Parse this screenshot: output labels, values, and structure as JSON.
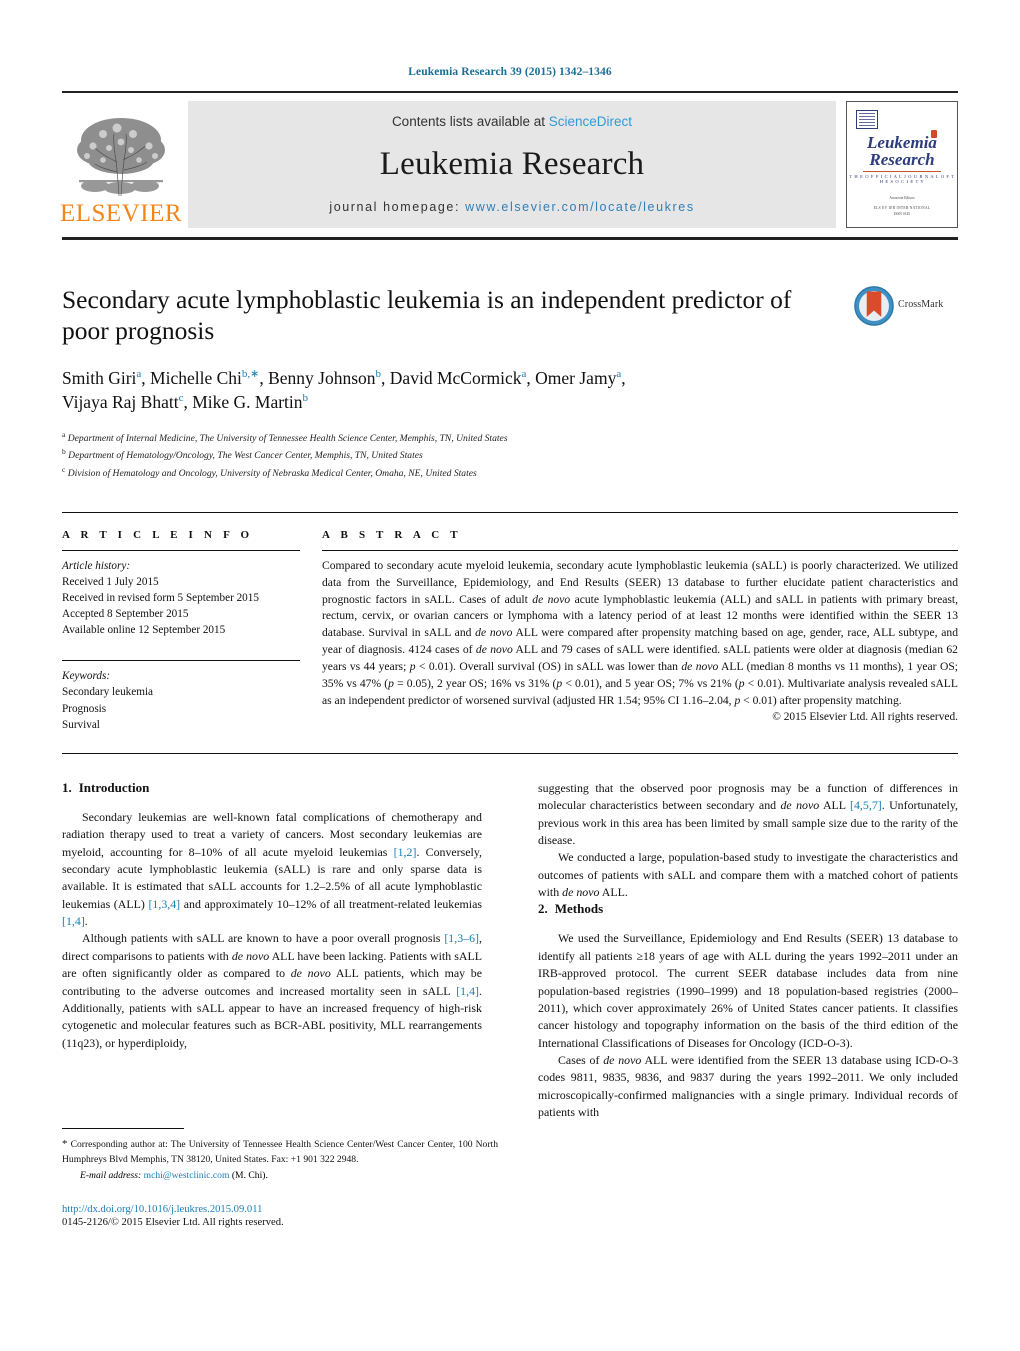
{
  "running_head": "Leukemia Research 39 (2015) 1342–1346",
  "masthead": {
    "publisher_name": "ELSEVIER",
    "contents_prefix": "Contents lists available at ",
    "contents_link": "ScienceDirect",
    "journal_title": "Leukemia Research",
    "homepage_prefix": "journal homepage: ",
    "homepage_link": "www.elsevier.com/locate/leukres",
    "cover": {
      "title_line1": "Leukemia",
      "title_line2": "Research",
      "subtitle": "T H E  O F F I C I A L  J O U R N A L  O F  T H E  S O C I E T Y",
      "meta_line1": "Associate Editors",
      "meta_line2": "ELS EV IER      INTER NATIONAL",
      "meta_line3": "ISSN                       0145"
    }
  },
  "article": {
    "title": "Secondary acute lymphoblastic leukemia is an independent predictor of poor prognosis",
    "authors_line1_parts": [
      {
        "name": "Smith Giri",
        "sup": "a",
        "sep": ", "
      },
      {
        "name": "Michelle Chi",
        "sup": "b,∗",
        "sep": ", "
      },
      {
        "name": "Benny Johnson",
        "sup": "b",
        "sep": ", "
      },
      {
        "name": "David McCormick",
        "sup": "a",
        "sep": ", "
      },
      {
        "name": "Omer Jamy",
        "sup": "a",
        "sep": ","
      }
    ],
    "authors_line2_parts": [
      {
        "name": "Vijaya Raj Bhatt",
        "sup": "c",
        "sep": ", "
      },
      {
        "name": "Mike G. Martin",
        "sup": "b",
        "sep": ""
      }
    ],
    "affiliations": [
      {
        "marker": "a",
        "text": "Department of Internal Medicine, The University of Tennessee Health Science Center, Memphis, TN, United States"
      },
      {
        "marker": "b",
        "text": "Department of Hematology/Oncology, The West Cancer Center, Memphis, TN, United States"
      },
      {
        "marker": "c",
        "text": "Division of Hematology and Oncology, University of Nebraska Medical Center, Omaha, NE, United States"
      }
    ],
    "crossmark_label": "CrossMark"
  },
  "article_info": {
    "heading": "A R T I C L E   I N F O",
    "history_label": "Article history:",
    "history": [
      "Received 1 July 2015",
      "Received in revised form 5 September 2015",
      "Accepted 8 September 2015",
      "Available online 12 September 2015"
    ],
    "keywords_label": "Keywords:",
    "keywords": [
      "Secondary leukemia",
      "Prognosis",
      "Survival"
    ]
  },
  "abstract": {
    "heading": "A B S T R A C T",
    "body_html": "Compared to secondary acute myeloid leukemia, secondary acute lymphoblastic leukemia (sALL) is poorly characterized. We utilized data from the Surveillance, Epidemiology, and End Results (SEER) 13 database to further elucidate patient characteristics and prognostic factors in sALL. Cases of adult <span class=\"ital\">de novo</span> acute lymphoblastic leukemia (ALL) and sALL in patients with primary breast, rectum, cervix, or ovarian cancers or lymphoma with a latency period of at least 12 months were identified within the SEER 13 database. Survival in sALL and <span class=\"ital\">de novo</span> ALL were compared after propensity matching based on age, gender, race, ALL subtype, and year of diagnosis. 4124 cases of <span class=\"ital\">de novo</span> ALL and 79 cases of sALL were identified. sALL patients were older at diagnosis (median 62 years vs 44 years; <span class=\"ital\">p</span> &lt; 0.01). Overall survival (OS) in sALL was lower than <span class=\"ital\">de novo</span> ALL (median 8 months vs 11 months), 1 year OS; 35% vs 47% (<span class=\"ital\">p</span> = 0.05), 2 year OS; 16% vs 31% (<span class=\"ital\">p</span> &lt; 0.01), and 5 year OS; 7% vs 21% (<span class=\"ital\">p</span> &lt; 0.01). Multivariate analysis revealed sALL as an independent predictor of worsened survival (adjusted HR 1.54; 95% CI 1.16–2.04, <span class=\"ital\">p</span> &lt; 0.01) after propensity matching.",
    "copyright": "© 2015 Elsevier Ltd. All rights reserved."
  },
  "sections": {
    "introduction": {
      "number": "1.",
      "title": "Introduction",
      "paragraphs_html": [
        "Secondary leukemias are well-known fatal complications of chemotherapy and radiation therapy used to treat a variety of cancers. Most secondary leukemias are myeloid, accounting for 8–10% of all acute myeloid leukemias <span class=\"ref\">[1,2]</span>. Conversely, secondary acute lymphoblastic leukemia (sALL) is rare and only sparse data is available. It is estimated that sALL accounts for 1.2–2.5% of all acute lymphoblastic leukemias (ALL) <span class=\"ref\">[1,3,4]</span> and approximately 10–12% of all treatment-related leukemias <span class=\"ref\">[1,4]</span>.",
        "Although patients with sALL are known to have a poor overall prognosis <span class=\"ref\">[1,3–6]</span>, direct comparisons to patients with <span class=\"ital\">de novo</span> ALL have been lacking. Patients with sALL are often significantly older as compared to <span class=\"ital\">de novo</span> ALL patients, which may be contributing to the adverse outcomes and increased mortality seen in sALL <span class=\"ref\">[1,4]</span>. Additionally, patients with sALL appear to have an increased frequency of high-risk cytogenetic and molecular features such as BCR-ABL positivity, MLL rearrangements (11q23), or hyperdiploidy,",
        "suggesting that the observed poor prognosis may be a function of differences in molecular characteristics between secondary and <span class=\"ital\">de novo</span> ALL <span class=\"ref\">[4,5,7]</span>. Unfortunately, previous work in this area has been limited by small sample size due to the rarity of the disease.",
        "We conducted a large, population-based study to investigate the characteristics and outcomes of patients with sALL and compare them with a matched cohort of patients with <span class=\"ital\">de novo</span> ALL."
      ]
    },
    "methods": {
      "number": "2.",
      "title": "Methods",
      "paragraphs_html": [
        "We used the Surveillance, Epidemiology and End Results (SEER) 13 database to identify all patients ≥18 years of age with ALL during the years 1992–2011 under an IRB-approved protocol. The current SEER database includes data from nine population-based registries (1990–1999) and 18 population-based registries (2000–2011), which cover approximately 26% of United States cancer patients. It classifies cancer histology and topography information on the basis of the third edition of the International Classifications of Diseases for Oncology (ICD-O-3).",
        "Cases of <span class=\"ital\">de novo</span> ALL were identified from the SEER 13 database using ICD-O-3 codes 9811, 9835, 9836, and 9837 during the years 1992–2011. We only included microscopically-confirmed malignancies with a single primary. Individual records of patients with"
      ]
    }
  },
  "footnote": {
    "corresponding_html": "<span style=\"font-size:11px\">*</span> Corresponding author at: The University of Tennessee Health Science Center/West Cancer Center, 100 North Humphreys Blvd Memphis, TN 38120, United States. Fax: +1 901 322 2948.",
    "email_label": "E-mail address:",
    "email": "mchi@westclinic.com",
    "email_suffix": "(M. Chi).",
    "doi": "http://dx.doi.org/10.1016/j.leukres.2015.09.011",
    "issn": "0145-2126/© 2015 Elsevier Ltd. All rights reserved."
  },
  "colors": {
    "link_blue": "#1a7fb5",
    "sciencedirect_blue": "#2e9bd6",
    "elsevier_orange": "#f2861d",
    "cover_navy": "#2d3c7a",
    "crossmark_red": "#d94b2b"
  }
}
